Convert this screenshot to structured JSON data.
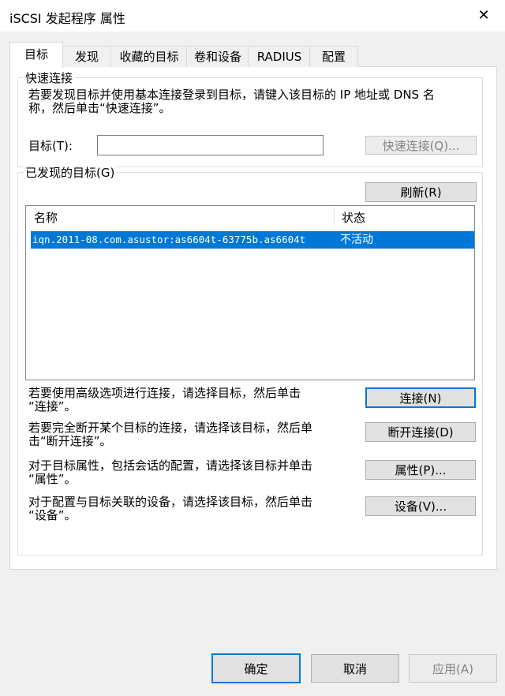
{
  "window": {
    "title": "iSCSI 发起程序 属性",
    "close_icon": "✕"
  },
  "tabs": [
    {
      "label": "目标"
    },
    {
      "label": "发现"
    },
    {
      "label": "收藏的目标"
    },
    {
      "label": "卷和设备"
    },
    {
      "label": "RADIUS"
    },
    {
      "label": "配置"
    }
  ],
  "quick_connect": {
    "group_label": "快速连接",
    "description_line1": "若要发现目标并使用基本连接登录到目标，请键入该目标的 IP 地址或 DNS 名",
    "description_line2": "称，然后单击“快速连接”。",
    "target_label": "目标(T):",
    "target_value": "",
    "button": "快速连接(Q)..."
  },
  "discovered": {
    "group_label": "已发现的目标(G)",
    "refresh_button": "刷新(R)",
    "columns": [
      "名称",
      "状态"
    ],
    "rows": [
      {
        "name": "iqn.2011-08.com.asustor:as6604t-63775b.as6604t",
        "status": "不活动"
      }
    ]
  },
  "actions": [
    {
      "desc1": "若要使用高级选项进行连接，请选择目标，然后单击",
      "desc2": "“连接”。",
      "button": "连接(N)"
    },
    {
      "desc1": "若要完全断开某个目标的连接，请选择该目标，然后单",
      "desc2": "击“断开连接”。",
      "button": "断开连接(D)"
    },
    {
      "desc1": "对于目标属性，包括会话的配置，请选择该目标并单击",
      "desc2": "“属性”。",
      "button": "属性(P)..."
    },
    {
      "desc1": "对于配置与目标关联的设备，请选择该目标，然后单击",
      "desc2": "“设备”。",
      "button": "设备(V)..."
    }
  ],
  "footer": {
    "ok": "确定",
    "cancel": "取消",
    "apply": "应用(A)"
  },
  "colors": {
    "selection": "#0078d7",
    "default_button_border": "#0078d7"
  }
}
